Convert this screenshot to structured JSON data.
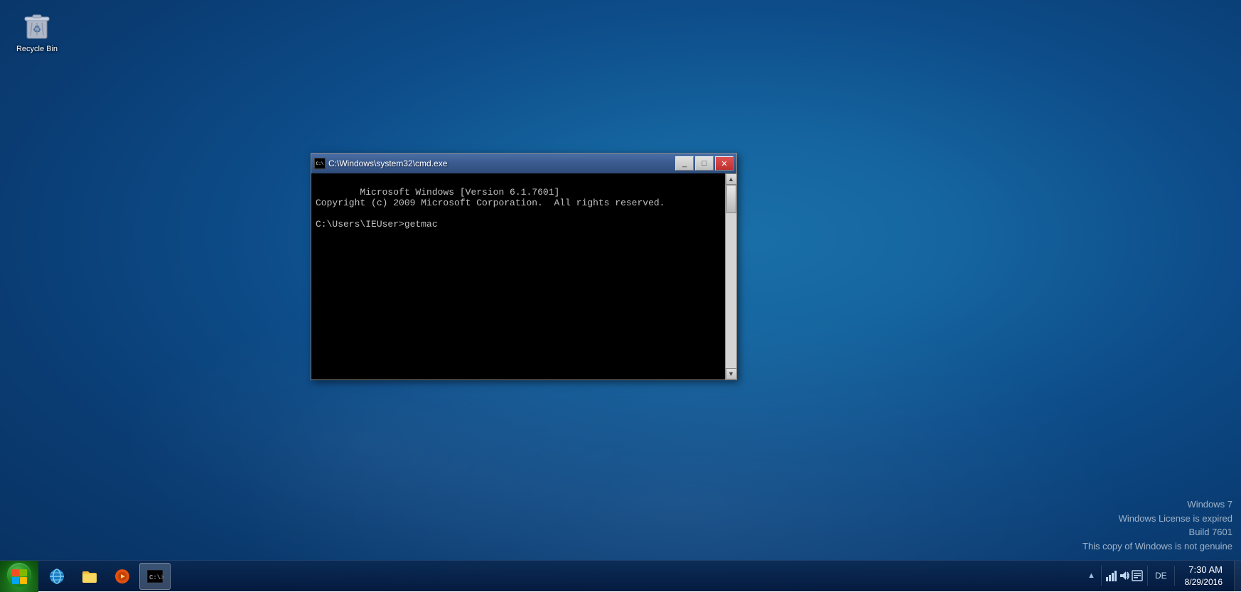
{
  "desktop": {
    "recycle_bin_label": "Recycle Bin"
  },
  "cmd_window": {
    "title": "C:\\Windows\\system32\\cmd.exe",
    "line1": "Microsoft Windows [Version 6.1.7601]",
    "line2": "Copyright (c) 2009 Microsoft Corporation.  All rights reserved.",
    "line3": "",
    "prompt": "C:\\Users\\IEUser>getmac",
    "minimize_label": "_",
    "maximize_label": "□",
    "close_label": "✕"
  },
  "taskbar": {
    "tray": {
      "de_label": "DE",
      "time": "7:30 AM",
      "date": "8/29/2016"
    }
  },
  "activation": {
    "line1": "Windows 7",
    "line2": "Windows License is expired",
    "line3": "Build 7601",
    "line4": "This copy of Windows is not genuine"
  }
}
